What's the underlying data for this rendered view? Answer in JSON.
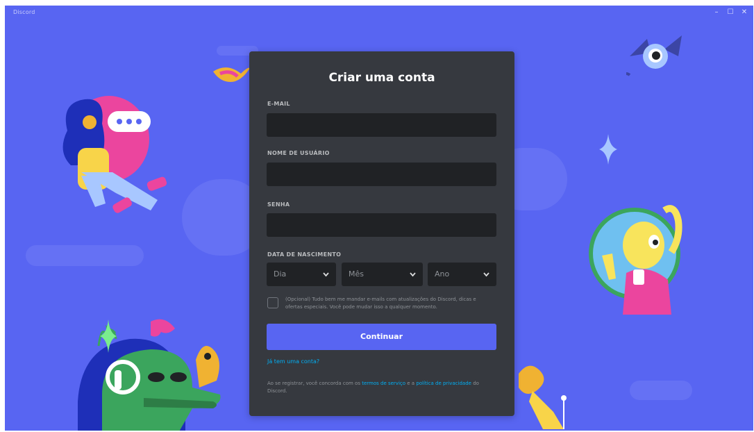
{
  "window": {
    "title": "Discord",
    "controls": [
      "minimize",
      "maximize",
      "close"
    ]
  },
  "form": {
    "title": "Criar uma conta",
    "email_label": "E-MAIL",
    "email_value": "",
    "username_label": "NOME DE USUÁRIO",
    "username_value": "",
    "password_label": "SENHA",
    "password_value": "",
    "dob_label": "DATA DE NASCIMENTO",
    "dob_day": "Dia",
    "dob_month": "Mês",
    "dob_year": "Ano",
    "optin_text": "(Opcional) Tudo bem me mandar e-mails com atualizações do Discord, dicas e ofertas especiais. Você pode mudar isso a qualquer momento.",
    "optin_checked": false,
    "submit_label": "Continuar",
    "login_link": "Já tem uma conta?",
    "legal_prefix": "Ao se registrar, você concorda com os",
    "terms_link": "termos de serviço",
    "legal_mid": "e a",
    "privacy_link": "política de privacidade",
    "legal_suffix": "do Discord."
  },
  "colors": {
    "background": "#5865f2",
    "card": "#36393f",
    "input": "#202225",
    "accent": "#5865f2",
    "link": "#00aff4"
  }
}
